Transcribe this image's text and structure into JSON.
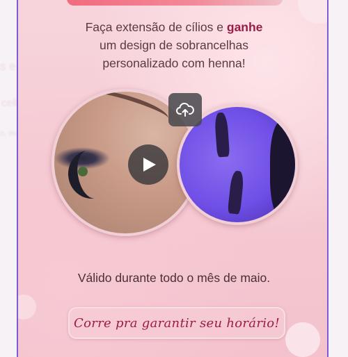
{
  "headline": {
    "line1_prefix": "Faça extensão de cílios e ",
    "line1_bold": "ganhe",
    "line2": "um design de sobrancelhas",
    "line3": "personalizado com henna!"
  },
  "media": {
    "left_photo": "lash-extension-photo",
    "right_photo": "brow-henna-photo",
    "play_icon": "play-icon",
    "cloud_icon": "cloud-upload-icon"
  },
  "validity": "Válido durante todo o mês de maio.",
  "cta_label": "Corre pra garantir seu horário!",
  "colors": {
    "accent": "#9b1c46",
    "card_bg": "#f6cdd6",
    "frame": "#7c5bd8",
    "top_bar": "#f26a7e"
  }
}
